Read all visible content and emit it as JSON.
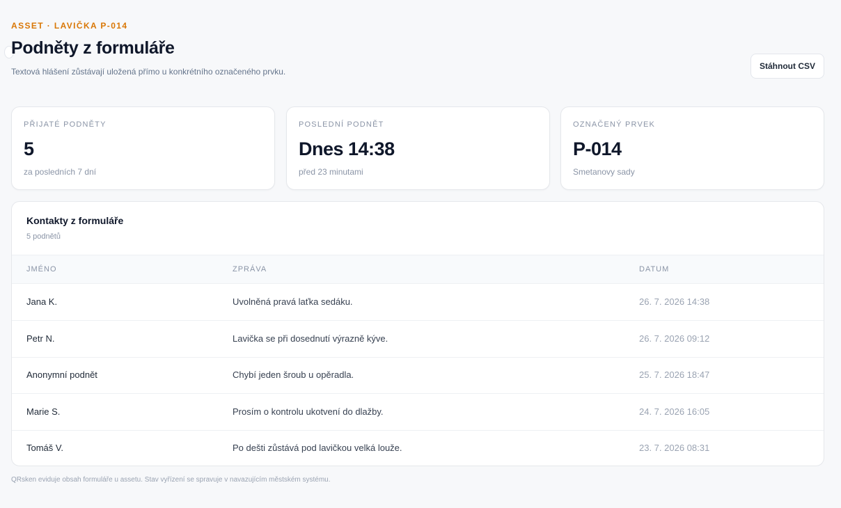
{
  "header": {
    "eyebrow": "ASSET · LAVIČKA P-014",
    "title": "Podněty z formuláře",
    "subtitle": "Textová hlášení zůstávají uložená přímo u konkrétního označeného prvku.",
    "csv_button_label": "Stáhnout CSV"
  },
  "stats": [
    {
      "label": "PŘIJATÉ PODNĚTY",
      "value": "5",
      "note": "za posledních 7 dní"
    },
    {
      "label": "POSLEDNÍ PODNĚT",
      "value": "Dnes 14:38",
      "note": "před 23 minutami"
    },
    {
      "label": "OZNAČENÝ PRVEK",
      "value": "P-014",
      "note": "Smetanovy sady"
    }
  ],
  "table": {
    "title": "Kontakty z formuláře",
    "count": "5 podnětů",
    "columns": [
      "JMÉNO",
      "ZPRÁVA",
      "DATUM"
    ],
    "rows": [
      {
        "name": "Jana K.",
        "message": "Uvolněná pravá laťka sedáku.",
        "date": "26. 7. 2026 14:38"
      },
      {
        "name": "Petr N.",
        "message": "Lavička se při dosednutí výrazně kýve.",
        "date": "26. 7. 2026 09:12"
      },
      {
        "name": "Anonymní podnět",
        "message": "Chybí jeden šroub u opěradla.",
        "date": "25. 7. 2026 18:47"
      },
      {
        "name": "Marie S.",
        "message": "Prosím o kontrolu ukotvení do dlažby.",
        "date": "24. 7. 2026 16:05"
      },
      {
        "name": "Tomáš V.",
        "message": "Po dešti zůstává pod lavičkou velká louže.",
        "date": "23. 7. 2026 08:31"
      }
    ]
  },
  "footer": {
    "note": "QRsken eviduje obsah formuláře u assetu. Stav vyřízení se spravuje v navazujícím městském systému."
  },
  "colors": {
    "accent": "#d97706",
    "background": "#f7f8fa"
  }
}
